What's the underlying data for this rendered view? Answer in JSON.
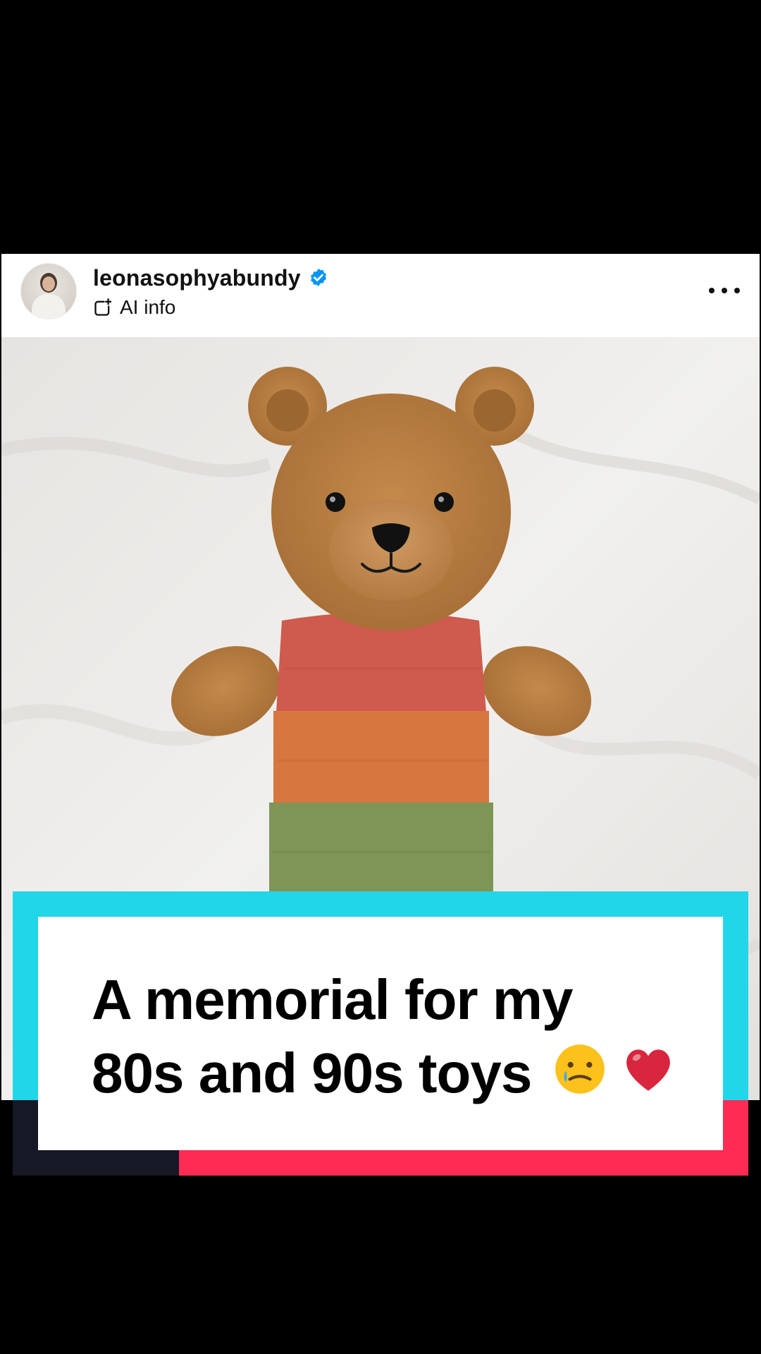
{
  "post": {
    "username": "leonasophyabundy",
    "verified": true,
    "ai_info_label": "AI info"
  },
  "image": {
    "subject": "teddy-bear-plush",
    "colors": {
      "blanket": "#efeeec",
      "fur": "#b57a3e",
      "stripe_red": "#cf5a4e",
      "stripe_orange": "#d7773f",
      "stripe_green": "#7f9556"
    }
  },
  "caption": {
    "line1": "A memorial for my",
    "line2": "80s and 90s toys",
    "emojis": [
      "sad-relieved-face",
      "red-heart"
    ],
    "colors": {
      "frame_cyan": "#22d6ea",
      "frame_red": "#fe2c55",
      "frame_dark": "#161826"
    }
  },
  "icons": {
    "verified": "verified-badge-icon",
    "ai": "ai-info-icon",
    "more": "more-options-icon"
  }
}
